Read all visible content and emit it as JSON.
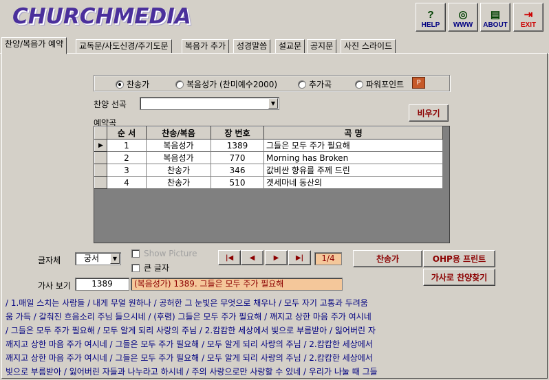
{
  "header": {
    "logo": "CHURCHMEDIA",
    "buttons": [
      {
        "icon": "?",
        "label": "HELP"
      },
      {
        "icon": "◎",
        "label": "WWW"
      },
      {
        "icon": "▤",
        "label": "ABOUT"
      },
      {
        "icon": "⇥",
        "label": "EXIT"
      }
    ]
  },
  "tabs": [
    "찬양/복음가 예약",
    "교독문/사도신경/주기도문",
    "복음가 추가",
    "성경말씀",
    "설교문",
    "공지문",
    "사진 스라이드"
  ],
  "options": {
    "items": [
      "찬송가",
      "복음성가 (찬미예수2000)",
      "추가곡",
      "파워포인트"
    ],
    "selected_index": 0
  },
  "song_select": {
    "label": "찬양 선곡",
    "value": ""
  },
  "clear_button": "비우기",
  "reservation": {
    "label": "예약곡",
    "columns": [
      "순 서",
      "찬송/복음",
      "장 번호",
      "곡 명"
    ],
    "rows": [
      {
        "order": "1",
        "type": "복음성가",
        "number": "1389",
        "title": "그들은 모두 주가 필요해"
      },
      {
        "order": "2",
        "type": "복음성가",
        "number": "770",
        "title": "Morning has Broken"
      },
      {
        "order": "3",
        "type": "찬송가",
        "number": "346",
        "title": "값비싼 향유를 주께 드린"
      },
      {
        "order": "4",
        "type": "찬송가",
        "number": "510",
        "title": "겟세마네 동산의"
      }
    ]
  },
  "font": {
    "label": "글자체",
    "value": "궁서"
  },
  "show_picture": "Show Picture",
  "big_text": "큰 글자",
  "pager": "1/4",
  "buttons": {
    "hymn": "찬송가",
    "ohp_print": "OHP용 프린트",
    "find_by_lyrics": "가사로 찬양찾기"
  },
  "lyrics_view": {
    "label": "가사 보기",
    "number": "1389",
    "title": "(복음성가) 1389. 그들은 모두 주가 필요해"
  },
  "lyrics": [
    " / 1.매일 스치는 사람들 /    내게 무얼 원하나 /    공허한 그 눈빛은 무엇으로 채우나 /    모두 자기 고통과 두려움",
    "움 가득 /    갈춰진 흐음소리 주님 들으시네 /    (후렴) 그들은 모두 주가 필요해 /    깨지고 상한 마음 주가 여시네",
    " /    그들은 모두 주가 필요해 /    모두 알게 되리 사랑의 주님 / 2.캄캄한 세상에서 빛으로 부름받아 /    잃어버린 자",
    "   깨지고 상한 마음 주가 여시네 /    그들은 모두 주가 필요해 /    모두 알게 되리 사랑의 주님 / 2.캄캄한 세상에서",
    "   깨지고 상한 마음 주가 여시네 /    그들은 모두 주가 필요해 /    모두 알게 되리 사랑의 주님 / 2.캄캄한 세상에서",
    " 빛으로 부름받아 /    잃어버린 자들과 나누라고 하시네 /    주의 사랑으로만 사랑할 수 있네 /    우리가 나눌 때 그들"
  ]
}
